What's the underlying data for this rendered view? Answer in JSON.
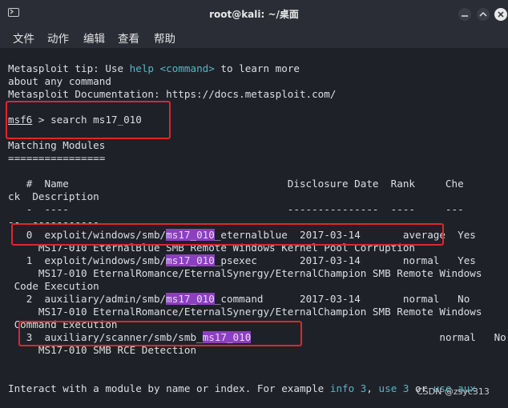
{
  "window": {
    "title": "root@kali: ~/桌面"
  },
  "menu": {
    "file": "文件",
    "action": "动作",
    "edit": "编辑",
    "view": "查看",
    "help": "帮助"
  },
  "terminal": {
    "tip_a": "Metasploit tip: Use ",
    "tip_help": "help",
    "tip_cmd": "<command>",
    "tip_b": " to learn more",
    "tip_line2": "about any command",
    "doc_line": "Metasploit Documentation: https://docs.metasploit.com/",
    "prompt_word": "msf6",
    "prompt_cmd": " > search ms17_010",
    "matching": "Matching Modules",
    "matching_ul": "================",
    "header_a": "   #  Name                                    Disclosure Date  Rank     Che",
    "header_b": "ck  Description",
    "sep_a": "   -  ----                                    ---------------  ----     ---",
    "sep_b": "--  -----------",
    "modules": [
      {
        "num": "   0  ",
        "pre": "exploit/windows/smb/",
        "hl": "ms17_010",
        "post": "_eternalblue  ",
        "rest": "2017-03-14       average  Yes",
        "desc": "     MS17-010 EternalBlue SMB Remote Windows Kernel Pool Corruption",
        "desc2": ""
      },
      {
        "num": "   1  ",
        "pre": "exploit/windows/smb/",
        "hl": "ms17_010",
        "post": "_psexec       ",
        "rest": "2017-03-14       normal   Yes",
        "desc": "     MS17-010 EternalRomance/EternalSynergy/EternalChampion SMB Remote Windows",
        "desc2": " Code Execution"
      },
      {
        "num": "   2  ",
        "pre": "auxiliary/admin/smb/",
        "hl": "ms17_010",
        "post": "_command      ",
        "rest": "2017-03-14       normal   No",
        "desc": "     MS17-010 EternalRomance/EternalSynergy/EternalChampion SMB Remote Windows",
        "desc2": " Command Execution"
      },
      {
        "num": "   3  ",
        "pre": "auxiliary/scanner/smb/smb_",
        "hl": "ms17_010",
        "post": "                               ",
        "rest": "normal   No",
        "desc": "     MS17-010 SMB RCE Detection",
        "desc2": ""
      }
    ],
    "interact_a": "Interact with a module by name or index. For example ",
    "interact_info": "info 3",
    "interact_b": ", ",
    "interact_use": "use 3",
    "interact_c": " or ",
    "interact_aux": "use aux"
  },
  "watermark": "CSDN @zsyc313"
}
